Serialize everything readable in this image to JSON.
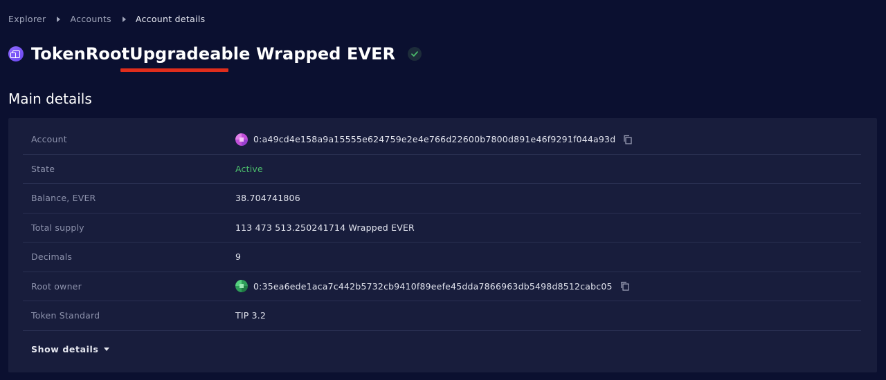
{
  "breadcrumb": {
    "items": [
      "Explorer",
      "Accounts",
      "Account details"
    ]
  },
  "header": {
    "title": "TokenRootUpgradeable Wrapped EVER",
    "token_icon": "token-cube-icon",
    "verified_icon": "check-icon"
  },
  "annotation": {
    "color": "#e02d1c",
    "target_text": "Upgradeable"
  },
  "main_details": {
    "title": "Main details",
    "rows": [
      {
        "label": "Account",
        "value": "0:a49cd4e158a9a15555e624759e2e4e766d22600b7800d891e46f9291f044a93d"
      },
      {
        "label": "State",
        "value": "Active"
      },
      {
        "label": "Balance, EVER",
        "value": "38.704741806"
      },
      {
        "label": "Total supply",
        "value": "113 473 513.250241714 Wrapped EVER"
      },
      {
        "label": "Decimals",
        "value": "9"
      },
      {
        "label": "Root owner",
        "value": "0:35ea6ede1aca7c442b5732cb9410f89eefe45dda7866963db5498d8512cabc05"
      },
      {
        "label": "Token Standard",
        "value": "TIP 3.2"
      }
    ],
    "show_details": "Show details"
  },
  "colors": {
    "background": "#0b1030",
    "card": "#181d3c",
    "active": "#4bbd6c",
    "accent": "#7a58f6"
  }
}
